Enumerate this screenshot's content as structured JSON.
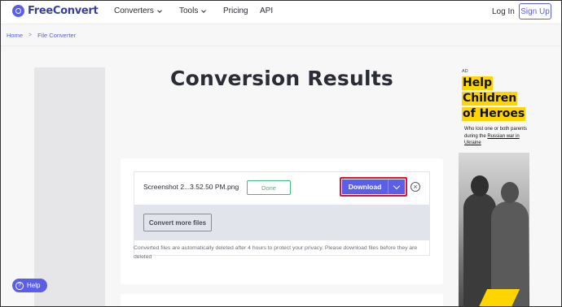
{
  "header": {
    "logo_text": "FreeConvert",
    "nav": [
      {
        "label": "Converters"
      },
      {
        "label": "Tools"
      },
      {
        "label": "Pricing"
      },
      {
        "label": "API"
      }
    ],
    "login_label": "Log In",
    "signup_label": "Sign Up"
  },
  "breadcrumb": {
    "home": "Home",
    "separator": ">",
    "current": "File Converter"
  },
  "main": {
    "title": "Conversion Results",
    "file": {
      "name": "Screenshot 2...3.52.50 PM.png",
      "status": "Done",
      "download_label": "Download"
    },
    "convert_more_label": "Convert more files",
    "privacy_note": "Converted files are automatically deleted after 4 hours to protect your privacy. Please download files before they are deleted"
  },
  "ad": {
    "label": "AD",
    "headline_lines": [
      "Help",
      "Children",
      "of Heroes"
    ],
    "sub_prefix": "Who lost one or both parents during the ",
    "sub_link": "Russian war in Ukraine"
  },
  "help": {
    "label": "Help"
  },
  "colors": {
    "accent": "#5b5fe8",
    "done": "#39c07a",
    "highlight": "#e0142b",
    "ad_yellow": "#ffd500"
  },
  "icons": [
    "logo-icon",
    "chevron-down-icon",
    "close-circle-icon",
    "help-icon"
  ]
}
